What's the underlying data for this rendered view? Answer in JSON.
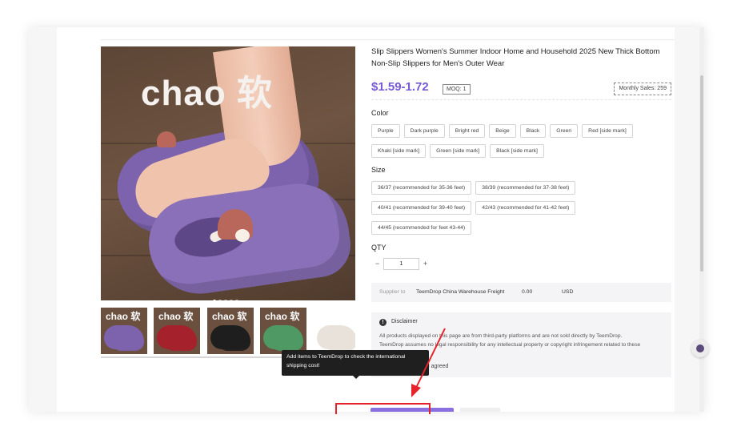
{
  "product": {
    "title": "Slip Slippers Women's Summer Indoor Home and Household 2025 New Thick Bottom Non-Slip Slippers for Men's Outer Wear",
    "price": "$1.59-1.72",
    "moq": "MOQ: 1",
    "monthly_sales": "Monthly Sales: 259",
    "image_brand_text": "chao 软"
  },
  "thumbnails": [
    {
      "label": "chao 软",
      "color": "#7d63ad",
      "bg": "#6b5040"
    },
    {
      "label": "chao 软",
      "color": "#a5212c",
      "bg": "#6b5040"
    },
    {
      "label": "chao 软",
      "color": "#1e1e1e",
      "bg": "#6b5040"
    },
    {
      "label": "chao 软",
      "color": "#4f9a64",
      "bg": "#6b5040"
    },
    {
      "label": "",
      "color": "#e8e2da",
      "bg": "#ffffff"
    }
  ],
  "color": {
    "label": "Color",
    "options": [
      "Purple",
      "Dark purple",
      "Bright red",
      "Beige",
      "Black",
      "Green",
      "Red [side mark]",
      "Khaki [side mark]",
      "Green [side mark]",
      "Black [side mark]"
    ]
  },
  "size": {
    "label": "Size",
    "options": [
      "36/37 (recommended for 35-36 feet)",
      "38/39 (recommended for 37-38 feet)",
      "40/41 (recommended for 39-40 feet)",
      "42/43 (recommended for 41-42 feet)",
      "44/45 (recommended for feet 43-44)"
    ]
  },
  "qty": {
    "label": "QTY",
    "minus": "−",
    "plus": "+",
    "value": "1"
  },
  "supplier": {
    "label": "Supplier to",
    "name": "TeemDrop China Warehouse Freight",
    "value": "0.00",
    "currency": "USD"
  },
  "disclaimer": {
    "icon": "!",
    "title": "Disclaimer",
    "text": "All products displayed on this page are from third-party platforms and are not sold directly by TeemDrop. TeemDrop assumes no legal responsibility for any intellectual property or copyright infringement related to these products.",
    "agree_label": "I have read and agreed"
  },
  "tooltip": {
    "text": "Add items to TeemDrop to check the international shipping cost!"
  },
  "colors": {
    "accent": "#7759d6",
    "button": "#8a6fe0",
    "highlight": "#e4232b"
  }
}
